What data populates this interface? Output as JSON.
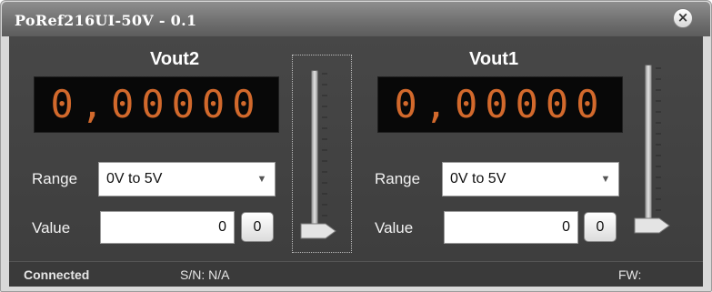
{
  "window": {
    "title": "PoRef216UI-50V - 0.1",
    "close_label": "×"
  },
  "channels": [
    {
      "name": "Vout2",
      "display": "0,00000",
      "range_label": "Range",
      "range_value": "0V to 5V",
      "value_label": "Value",
      "value": "0",
      "zero_button": "0",
      "slider_level": 0
    },
    {
      "name": "Vout1",
      "display": "0,00000",
      "range_label": "Range",
      "range_value": "0V to 5V",
      "value_label": "Value",
      "value": "0",
      "zero_button": "0",
      "slider_level": 0
    }
  ],
  "status": {
    "connection": "Connected",
    "serial": "S/N: N/A",
    "firmware": "FW:"
  },
  "colors": {
    "lcd_digits": "#d2692c",
    "panel": "#444444",
    "titlebar": "#767676"
  },
  "icons": {
    "close": "close-icon",
    "dropdown": "chevron-down-icon",
    "slider_thumb": "slider-thumb-icon"
  }
}
